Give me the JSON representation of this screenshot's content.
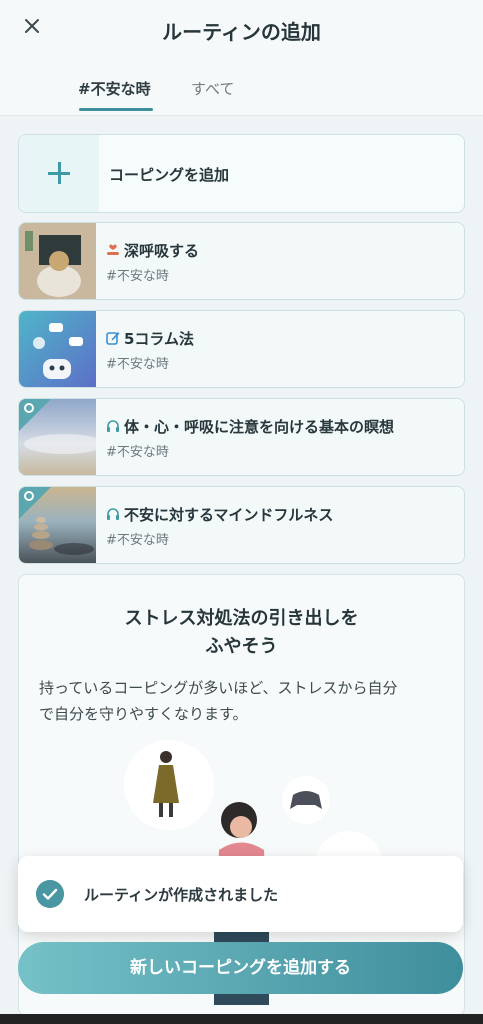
{
  "header": {
    "title": "ルーティンの追加",
    "close_icon": "close-icon"
  },
  "tabs": [
    {
      "label": "#不安な時",
      "active": true
    },
    {
      "label": "すべて",
      "active": false
    }
  ],
  "add_coping": {
    "label": "コーピングを追加",
    "icon": "plus-icon"
  },
  "items": [
    {
      "title": "深呼吸する",
      "tag": "#不安な時",
      "icon": "hand-heart-icon"
    },
    {
      "title": "5コラム法",
      "tag": "#不安な時",
      "icon": "edit-icon"
    },
    {
      "title": "体・心・呼吸に注意を向ける基本の瞑想",
      "tag": "#不安な時",
      "icon": "headphones-icon"
    },
    {
      "title": "不安に対するマインドフルネス",
      "tag": "#不安な時",
      "icon": "headphones-icon"
    }
  ],
  "info": {
    "title_line1": "ストレス対処法の引き出しを",
    "title_line2": "ふやそう",
    "body_line1": "持っているコーピングが多いほど、ストレスから自分",
    "body_line2": "で自分を守りやすくなります。"
  },
  "toast": {
    "label": "ルーティンが作成されました",
    "icon": "check-circle-icon"
  },
  "cta": {
    "label": "新しいコーピングを追加する"
  },
  "colors": {
    "accent": "#3f8f9c",
    "background": "#eef4f5"
  }
}
